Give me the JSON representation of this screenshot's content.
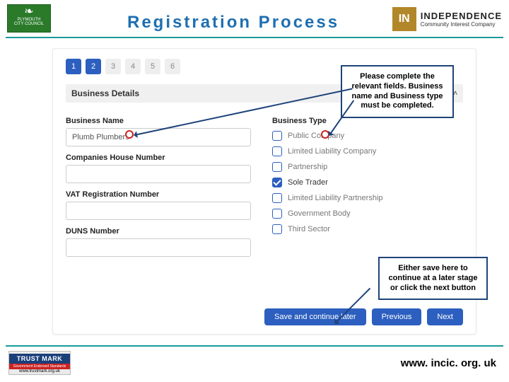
{
  "header": {
    "plymouth_line1": "PLYMOUTH",
    "plymouth_line2": "CITY COUNCIL",
    "title": "Registration Process",
    "in_badge": "IN",
    "in_big": "INDEPENDENCE",
    "in_small": "Community Interest Company"
  },
  "form": {
    "steps": [
      "1",
      "2",
      "3",
      "4",
      "5",
      "6"
    ],
    "active_steps": [
      0,
      1
    ],
    "section_title": "Business Details",
    "labels": {
      "business_name": "Business Name",
      "business_type": "Business Type",
      "companies_house": "Companies House Number",
      "vat": "VAT Registration Number",
      "duns": "DUNS Number"
    },
    "values": {
      "business_name": "Plumb Plumbers",
      "companies_house": "",
      "vat": "",
      "duns": ""
    },
    "business_types": [
      {
        "label": "Public Company",
        "checked": false
      },
      {
        "label": "Limited Liability Company",
        "checked": false
      },
      {
        "label": "Partnership",
        "checked": false
      },
      {
        "label": "Sole Trader",
        "checked": true
      },
      {
        "label": "Limited Liability Partnership",
        "checked": false
      },
      {
        "label": "Government Body",
        "checked": false
      },
      {
        "label": "Third Sector",
        "checked": false
      }
    ],
    "buttons": {
      "save": "Save and continue later",
      "previous": "Previous",
      "next": "Next"
    }
  },
  "callouts": {
    "c1": "Please complete the relevant fields. Business name and Business type must be completed.",
    "c2": "Either save here to continue at a later stage or click the next button"
  },
  "footer": {
    "tm_top": "TRUST MARK",
    "tm_mid": "Government Endorsed Standards",
    "tm_url": "www.trustmark.org.uk",
    "url": "www. incic. org. uk"
  }
}
